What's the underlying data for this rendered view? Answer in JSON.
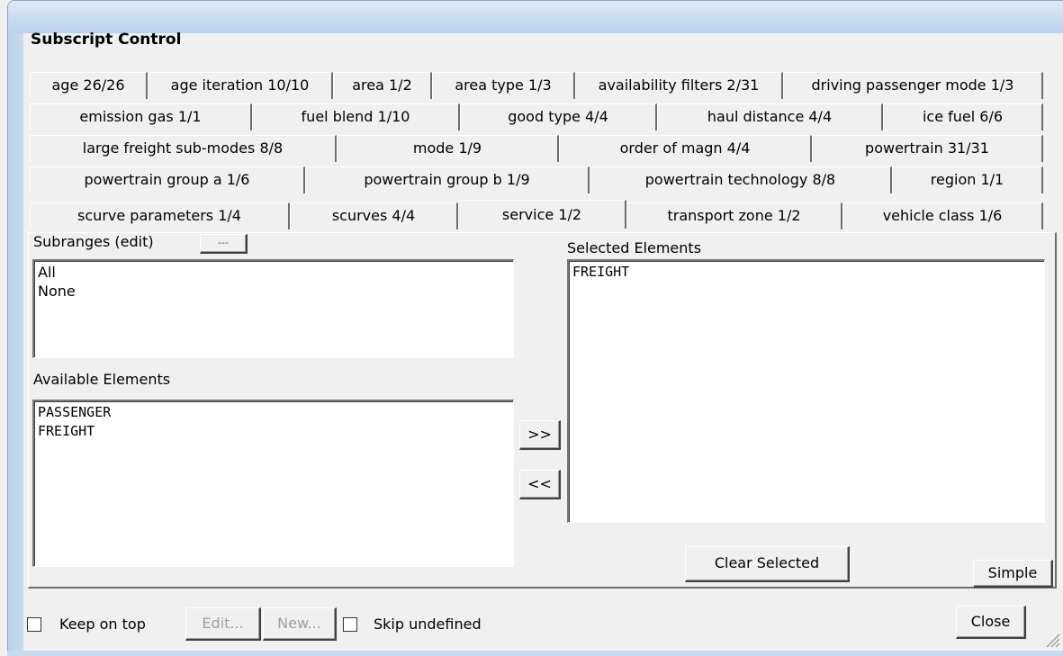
{
  "window": {
    "title": "Subscript Control"
  },
  "tabs": {
    "rows": [
      [
        "age  26/26",
        "age iteration  10/10",
        "area  1/2",
        "area type  1/3",
        "availability filters  2/31",
        "driving passenger mode  1/3"
      ],
      [
        "emission gas  1/1",
        "fuel blend  1/10",
        "good type  4/4",
        "haul distance  4/4",
        "ice fuel  6/6"
      ],
      [
        "large freight sub-modes  8/8",
        "mode  1/9",
        "order of magn  4/4",
        "powertrain  31/31"
      ],
      [
        "powertrain group a  1/6",
        "powertrain group b  1/9",
        "powertrain technology  8/8",
        "region  1/1"
      ],
      [
        "scurve parameters  1/4",
        "scurves  4/4",
        "service  1/2",
        "transport zone  1/2",
        "vehicle class  1/6"
      ]
    ],
    "active": "service  1/2"
  },
  "subranges": {
    "label": "Subranges (edit)",
    "edit_button": "---",
    "items": [
      "All",
      "None"
    ]
  },
  "available": {
    "label": "Available Elements",
    "items": [
      "PASSENGER",
      "FREIGHT"
    ]
  },
  "selected": {
    "label": "Selected Elements",
    "items": [
      "FREIGHT"
    ]
  },
  "buttons": {
    "add": ">>",
    "remove": "<<",
    "clear_selected": "Clear Selected",
    "simple": "Simple",
    "edit": "Edit...",
    "new": "New...",
    "close": "Close"
  },
  "checkboxes": {
    "keep_on_top": "Keep on top",
    "skip_undefined": "Skip undefined"
  }
}
